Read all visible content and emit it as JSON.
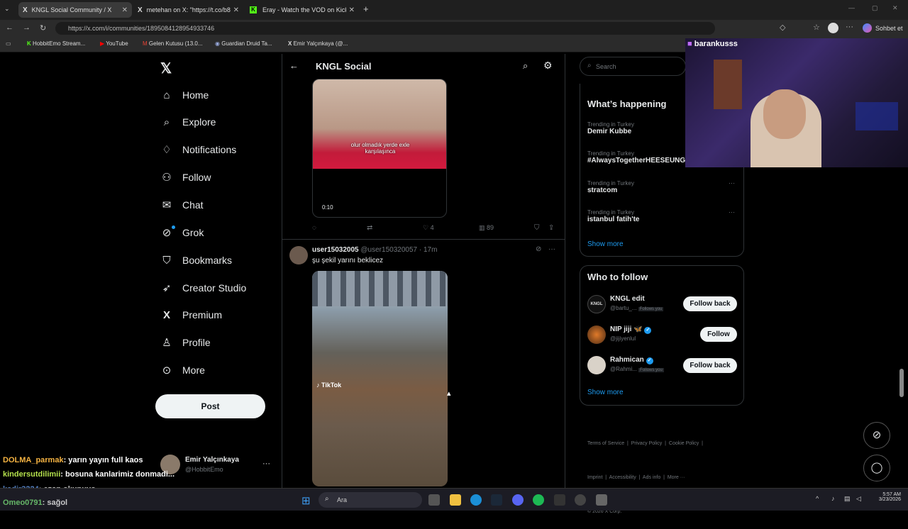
{
  "browser": {
    "tabs": [
      {
        "title": "KNGL Social Community / X",
        "active": true
      },
      {
        "title": "metehan on X: \"https://t.co/b81K...",
        "active": false
      },
      {
        "title": "Eray - Watch the VOD on Kick",
        "active": false
      }
    ],
    "url": "https://x.com/i/communities/1895084128954933746",
    "profile_button": "Sohbet et",
    "bookmarks": [
      "HobbitEmo Stream...",
      "YouTube",
      "Gelen Kutusu (13.0...",
      "Guardian Druid Ta...",
      "Emir Yalçınkaya (@..."
    ]
  },
  "nav": {
    "items": [
      "Home",
      "Explore",
      "Notifications",
      "Follow",
      "Chat",
      "Grok",
      "Bookmarks",
      "Creator Studio",
      "Premium",
      "Profile",
      "More"
    ],
    "post_label": "Post",
    "account_name": "Emir Yalçınkaya",
    "account_handle": "@HobbitEmo"
  },
  "community": {
    "title": "KNGL Social"
  },
  "post1": {
    "caption_line1": "olur olmadık yerde exle",
    "caption_line2": "karşılaşınca",
    "duration": "0:10",
    "likes": "4",
    "views": "89"
  },
  "post2": {
    "name": "user15032005",
    "handle": "@user150320057",
    "time": "· 17m",
    "text": "şu şekil yarını beklicez",
    "watermark": "TikTok"
  },
  "sidebar": {
    "search_placeholder": "Search",
    "whats_happening": "What’s happening",
    "trends": [
      {
        "category": "Trending in Turkey",
        "name": "Demir Kubbe"
      },
      {
        "category": "Trending in Turkey",
        "name": "#AlwaysTogetherHEESEUNG"
      },
      {
        "category": "Trending in Turkey",
        "name": "stratcom"
      },
      {
        "category": "Trending in Turkey",
        "name": "istanbul fatih'te"
      }
    ],
    "show_more": "Show more",
    "who_to_follow": "Who to follow",
    "suggestions": [
      {
        "name": "KNGL edit",
        "handle": "@bartu_...",
        "badge": "Follows you",
        "button": "Follow back"
      },
      {
        "name": "NIP jiji 🦋",
        "handle": "@jijiyenlul",
        "badge": "",
        "button": "Follow"
      },
      {
        "name": "Rahmican",
        "handle": "@Rahmi...",
        "badge": "Follows you",
        "button": "Follow back"
      }
    ],
    "show_more_2": "Show more",
    "footer_line1": "Terms of Service  |  Privacy Policy  |  Cookie Policy  |",
    "footer_line2": "Imprint  |  Accessibility  |  Ads info  |  More ···",
    "footer_line3": "© 2026 X Corp."
  },
  "stream": {
    "streamer": "barankusss",
    "chat": [
      {
        "user": "DOLMA_parmak",
        "msg": ": yarın yayın full kaos",
        "color": "#f5b342"
      },
      {
        "user": "kindersutdilimii",
        "msg": ": bosuna kanlarimiz donmadi...",
        "color": "#b4e04c"
      },
      {
        "user": "kadir3224",
        "msg": ": ezan okunuyo",
        "color": "#6fa8ff"
      },
      {
        "user": "Omeo0791",
        "msg": ": sağol",
        "color": "#7ee87e"
      }
    ]
  },
  "taskbar": {
    "search": "Ara",
    "time": "5:57 AM",
    "date": "3/23/2026"
  }
}
